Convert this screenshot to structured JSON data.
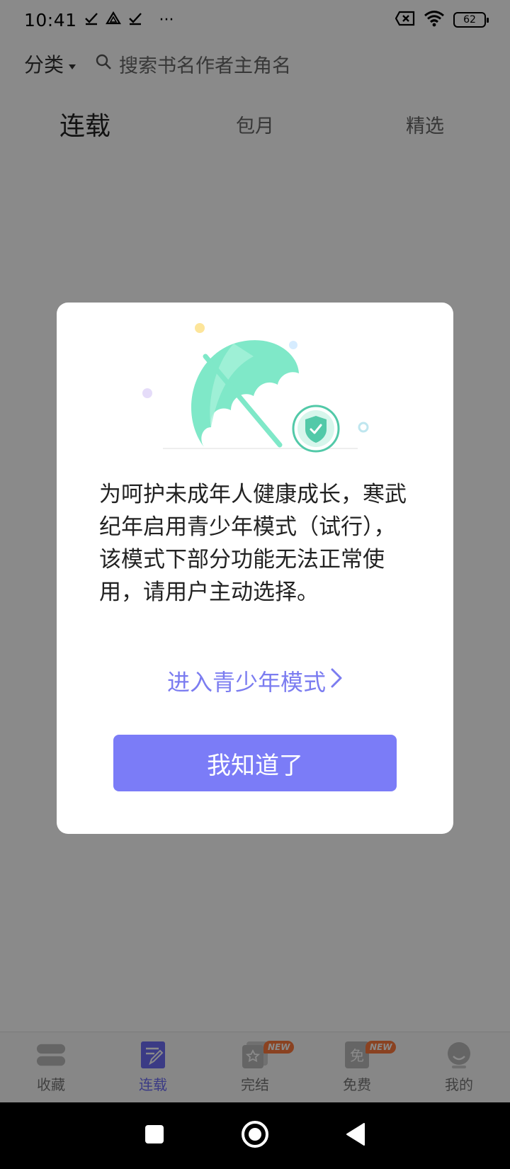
{
  "status_bar": {
    "time": "10:41",
    "more": "···",
    "battery": "62"
  },
  "top_bar": {
    "sort_label": "分类",
    "search_text": "搜索书名作者主角名"
  },
  "tabs": [
    {
      "label": "连载"
    },
    {
      "label": "包月"
    },
    {
      "label": "精选"
    }
  ],
  "dialog": {
    "message": "为呵护未成年人健康成长，寒武纪年启用青少年模式（试行），该模式下部分功能无法正常使用，请用户主动选择。",
    "teen_mode_link": "进入青少年模式",
    "confirm_button": "我知道了"
  },
  "bottom_nav": [
    {
      "label": "收藏",
      "icon": "bookshelf-icon",
      "active": false
    },
    {
      "label": "连载",
      "icon": "serial-icon",
      "active": true
    },
    {
      "label": "完结",
      "icon": "completed-icon",
      "active": false,
      "badge": "NEW"
    },
    {
      "label": "免费",
      "icon": "free-icon",
      "active": false,
      "badge": "NEW"
    },
    {
      "label": "我的",
      "icon": "profile-icon",
      "active": false
    }
  ],
  "colors": {
    "accent": "#7b7cf7",
    "link": "#7b7cf0",
    "umbrella": "#7fe8c8",
    "shield": "#52c9a8",
    "badge": "#ff7a3d"
  }
}
